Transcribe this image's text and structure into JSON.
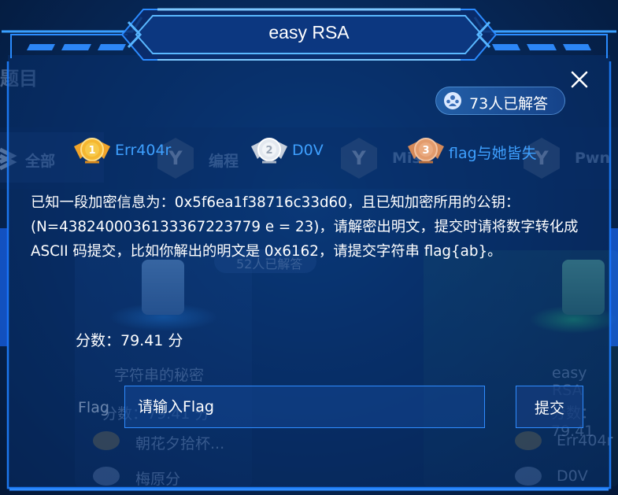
{
  "background": {
    "section_title_partial": "题目",
    "tabs": [
      {
        "label": "全部"
      },
      {
        "label": "编程"
      },
      {
        "label": "Misc"
      },
      {
        "label": "Pwn"
      }
    ],
    "card_left": {
      "solved_partial": "52人已解答",
      "score": "分数：79.41 分",
      "title": "字符串的秘密",
      "flag_label": "Flag",
      "score_row": "分数：79.41 分",
      "solvers": [
        "朝花夕拾杯...",
        "梅原分"
      ]
    },
    "card_right": {
      "title": "easy RSA",
      "score_partial": "分数：79.41",
      "solvers": [
        "Err404r",
        "D0V"
      ]
    }
  },
  "modal": {
    "title": "easy RSA",
    "solved_count": "73人已解答",
    "close_icon": "close-icon",
    "top_solvers": [
      {
        "rank": 1,
        "name": "Err404r",
        "medal": "gold-medal-icon"
      },
      {
        "rank": 2,
        "name": "D0V",
        "medal": "silver-medal-icon"
      },
      {
        "rank": 3,
        "name": "flag与她皆失",
        "medal": "bronze-medal-icon"
      }
    ],
    "description": "已知一段加密信息为：0x5f6ea1f38716c33d60，且已知加密所用的公钥：(N=438240003613336722377​9 e = 23)，请解密出明文，提交时请将数字转化成 ASCII 码提交，比如你解出的明文是 0x6162，请提交字符串 flag{ab}。",
    "score": "分数：79.41 分",
    "flag_placeholder": "请输入Flag",
    "flag_value": "",
    "submit_label": "提交"
  },
  "colors": {
    "accent": "#2f8cff",
    "solver_name": "#3ea0ff",
    "background": "#072a5c"
  }
}
